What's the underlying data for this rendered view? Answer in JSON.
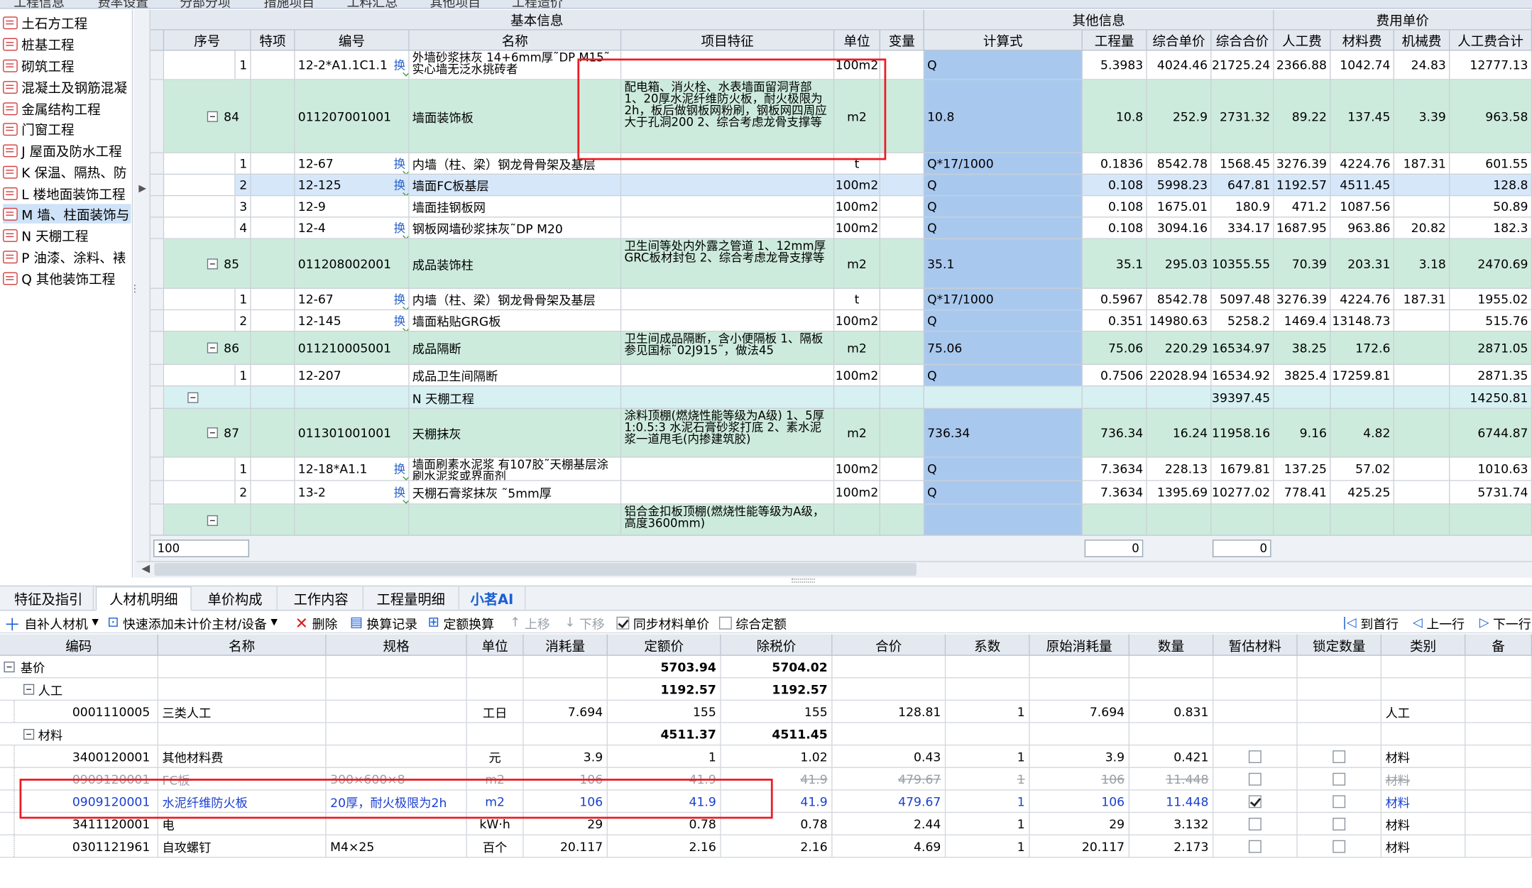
{
  "top_tabs": [
    "工程信息",
    "费率设置",
    "分部分项",
    "措施项目",
    "工料汇总",
    "其他项目",
    "工程造价"
  ],
  "left_tree": {
    "items": [
      "土石方工程",
      "桩基工程",
      "砌筑工程",
      "混凝土及钢筋混凝",
      "金属结构工程",
      "门窗工程",
      "J 屋面及防水工程",
      "K 保温、隔热、防",
      "L 楼地面装饰工程",
      "M 墙、柱面装饰与",
      "N 天棚工程",
      "P 油漆、涂料、裱",
      "Q 其他装饰工程"
    ],
    "selected_index": 9
  },
  "grid": {
    "group_headers": {
      "basic": "基本信息",
      "other": "其他信息",
      "fee": "费用单价"
    },
    "columns": [
      "序号",
      "特项",
      "编号",
      "名称",
      "项目特征",
      "单位",
      "变量",
      "计算式",
      "工程量",
      "综合单价",
      "综合合价",
      "人工费",
      "材料费",
      "机械费",
      "人工费合计"
    ],
    "rows": [
      {
        "seq": "1",
        "code": "12-2*A1.1C1.1",
        "huan": "换",
        "name": "外墙砂浆抹灰 14+6mm厚˜DP M15˜实心墙无泛水挑砖者",
        "feature": "",
        "unit": "100m2",
        "expr": "Q",
        "qty": "5.3983",
        "uprice": "4024.46",
        "total": "21725.24",
        "labor": "2366.88",
        "material": "1042.74",
        "machine": "24.83",
        "labor_total": "12777.13"
      },
      {
        "seq": "84",
        "code": "011207001001",
        "huan": "",
        "name": "墙面装饰板",
        "feature": "配电箱、消火栓、水表墙面留洞背部 1、20厚水泥纤维防火板，耐火极限为2h，板后做钢板网粉刷，钢板网四周应大于孔洞200 2、综合考虑龙骨支撑等",
        "unit": "m2",
        "expr": "10.8",
        "qty": "10.8",
        "uprice": "252.9",
        "total": "2731.32",
        "labor": "89.22",
        "material": "137.45",
        "machine": "3.39",
        "labor_total": "963.58"
      },
      {
        "seq": "1",
        "code": "12-67",
        "huan": "换",
        "name": "内墙（柱、梁）钢龙骨骨架及基层",
        "feature": "",
        "unit": "t",
        "expr": "Q*17/1000",
        "qty": "0.1836",
        "uprice": "8542.78",
        "total": "1568.45",
        "labor": "3276.39",
        "material": "4224.76",
        "machine": "187.31",
        "labor_total": "601.55"
      },
      {
        "seq": "2",
        "code": "12-125",
        "huan": "换",
        "name": "墙面FC板基层",
        "feature": "",
        "unit": "100m2",
        "expr": "Q",
        "qty": "0.108",
        "uprice": "5998.23",
        "total": "647.81",
        "labor": "1192.57",
        "material": "4511.45",
        "machine": "",
        "labor_total": "128.8"
      },
      {
        "seq": "3",
        "code": "12-9",
        "huan": "",
        "name": "墙面挂钢板网",
        "feature": "",
        "unit": "100m2",
        "expr": "Q",
        "qty": "0.108",
        "uprice": "1675.01",
        "total": "180.9",
        "labor": "471.2",
        "material": "1087.56",
        "machine": "",
        "labor_total": "50.89"
      },
      {
        "seq": "4",
        "code": "12-4",
        "huan": "换",
        "name": "钢板网墙砂浆抹灰˜DP M20",
        "feature": "",
        "unit": "100m2",
        "expr": "Q",
        "qty": "0.108",
        "uprice": "3094.16",
        "total": "334.17",
        "labor": "1687.95",
        "material": "963.86",
        "machine": "20.82",
        "labor_total": "182.3"
      },
      {
        "seq": "85",
        "code": "011208002001",
        "huan": "",
        "name": "成品装饰柱",
        "feature": "卫生间等处内外露之管道 1、12mm厚GRC板材封包 2、综合考虑龙骨支撑等",
        "unit": "m2",
        "expr": "35.1",
        "qty": "35.1",
        "uprice": "295.03",
        "total": "10355.55",
        "labor": "70.39",
        "material": "203.31",
        "machine": "3.18",
        "labor_total": "2470.69"
      },
      {
        "seq": "1",
        "code": "12-67",
        "huan": "换",
        "name": "内墙（柱、梁）钢龙骨骨架及基层",
        "feature": "",
        "unit": "t",
        "expr": "Q*17/1000",
        "qty": "0.5967",
        "uprice": "8542.78",
        "total": "5097.48",
        "labor": "3276.39",
        "material": "4224.76",
        "machine": "187.31",
        "labor_total": "1955.02"
      },
      {
        "seq": "2",
        "code": "12-145",
        "huan": "换",
        "name": "墙面粘贴GRG板",
        "feature": "",
        "unit": "100m2",
        "expr": "Q",
        "qty": "0.351",
        "uprice": "14980.63",
        "total": "5258.2",
        "labor": "1469.4",
        "material": "13148.73",
        "machine": "",
        "labor_total": "515.76"
      },
      {
        "seq": "86",
        "code": "011210005001",
        "huan": "",
        "name": "成品隔断",
        "feature": "卫生间成品隔断，含小便隔板 1、隔板参见国标˜02J915˜，做法45",
        "unit": "m2",
        "expr": "75.06",
        "qty": "75.06",
        "uprice": "220.29",
        "total": "16534.97",
        "labor": "38.25",
        "material": "172.6",
        "machine": "",
        "labor_total": "2871.05"
      },
      {
        "seq": "1",
        "code": "12-207",
        "huan": "",
        "name": "成品卫生间隔断",
        "feature": "",
        "unit": "100m2",
        "expr": "Q",
        "qty": "0.7506",
        "uprice": "22028.94",
        "total": "16534.92",
        "labor": "3825.4",
        "material": "17259.81",
        "machine": "",
        "labor_total": "2871.35"
      },
      {
        "seq": "",
        "code": "",
        "huan": "",
        "name": "N 天棚工程",
        "feature": "",
        "unit": "",
        "expr": "",
        "qty": "",
        "uprice": "",
        "total": "39397.45",
        "labor": "",
        "material": "",
        "machine": "",
        "labor_total": "14250.81"
      },
      {
        "seq": "87",
        "code": "011301001001",
        "huan": "",
        "name": "天棚抹灰",
        "feature": "涂料顶棚(燃烧性能等级为A级) 1、5厚1:0.5:3 水泥石膏砂浆打底 2、素水泥浆一道甩毛(内掺建筑胶)",
        "unit": "m2",
        "expr": "736.34",
        "qty": "736.34",
        "uprice": "16.24",
        "total": "11958.16",
        "labor": "9.16",
        "material": "4.82",
        "machine": "",
        "labor_total": "6744.87"
      },
      {
        "seq": "1",
        "code": "12-18*A1.1",
        "huan": "换",
        "name": "墙面刷素水泥浆 有107胶˜天棚基层涂刷水泥浆或界面剂",
        "feature": "",
        "unit": "100m2",
        "expr": "Q",
        "qty": "7.3634",
        "uprice": "228.13",
        "total": "1679.81",
        "labor": "137.25",
        "material": "57.02",
        "machine": "",
        "labor_total": "1010.63"
      },
      {
        "seq": "2",
        "code": "13-2",
        "huan": "换",
        "name": "天棚石膏浆抹灰 ˜5mm厚",
        "feature": "",
        "unit": "100m2",
        "expr": "Q",
        "qty": "7.3634",
        "uprice": "1395.69",
        "total": "10277.02",
        "labor": "778.41",
        "material": "425.25",
        "machine": "",
        "labor_total": "5731.74"
      },
      {
        "seq": "",
        "code": "",
        "huan": "",
        "name": "",
        "feature": "铝合金扣板顶棚(燃烧性能等级为A级，高度3600mm)",
        "unit": "",
        "expr": "",
        "qty": "",
        "uprice": "",
        "total": "",
        "labor": "",
        "material": "",
        "machine": "",
        "labor_total": ""
      }
    ],
    "summary": {
      "input_left": "100",
      "input_qty": "0",
      "input_total": "0"
    }
  },
  "bottom_tabs": [
    "特征及指引",
    "人材机明细",
    "单价构成",
    "工作内容",
    "工程量明细",
    "小茗AI"
  ],
  "bottom_active": 1,
  "toolbar": {
    "add": "自补人材机",
    "quick_add": "快速添加未计价主材/设备",
    "delete": "删除",
    "history": "换算记录",
    "quota": "定额换算",
    "up": "上移",
    "down": "下移",
    "sync": "同步材料单价",
    "combined": "综合定额",
    "first": "到首行",
    "prev": "上一行",
    "next": "下一行"
  },
  "detail": {
    "columns": [
      "编码",
      "名称",
      "规格",
      "单位",
      "消耗量",
      "定额价",
      "除税价",
      "合价",
      "系数",
      "原始消耗量",
      "数量",
      "暂估材料",
      "锁定数量",
      "类别",
      "备"
    ],
    "rows": [
      {
        "code": "基价",
        "name": "",
        "spec": "",
        "unit": "",
        "consume": "",
        "quota": "5703.94",
        "notax": "5704.02",
        "total": "",
        "coef": "",
        "orig": "",
        "qty": "",
        "est": null,
        "lock": null,
        "cat": ""
      },
      {
        "code": "人工",
        "name": "",
        "spec": "",
        "unit": "",
        "consume": "",
        "quota": "1192.57",
        "notax": "1192.57",
        "total": "",
        "coef": "",
        "orig": "",
        "qty": "",
        "est": null,
        "lock": null,
        "cat": ""
      },
      {
        "code": "0001110005",
        "name": "三类人工",
        "spec": "",
        "unit": "工日",
        "consume": "7.694",
        "quota": "155",
        "notax": "155",
        "total": "128.81",
        "coef": "1",
        "orig": "7.694",
        "qty": "0.831",
        "est": null,
        "lock": null,
        "cat": "人工"
      },
      {
        "code": "材料",
        "name": "",
        "spec": "",
        "unit": "",
        "consume": "",
        "quota": "4511.37",
        "notax": "4511.45",
        "total": "",
        "coef": "",
        "orig": "",
        "qty": "",
        "est": null,
        "lock": null,
        "cat": ""
      },
      {
        "code": "3400120001",
        "name": "其他材料费",
        "spec": "",
        "unit": "元",
        "consume": "3.9",
        "quota": "1",
        "notax": "1.02",
        "total": "0.43",
        "coef": "1",
        "orig": "3.9",
        "qty": "0.421",
        "est": false,
        "lock": false,
        "cat": "材料"
      },
      {
        "code": "0909120001",
        "name": "FC板",
        "spec": "300×600×8",
        "unit": "m2",
        "consume": "106",
        "quota": "41.9",
        "notax": "41.9",
        "total": "479.67",
        "coef": "1",
        "orig": "106",
        "qty": "11.448",
        "est": false,
        "lock": false,
        "cat": "材料"
      },
      {
        "code": "0909120001",
        "name": "水泥纤维防火板",
        "spec": "20厚，耐火极限为2h",
        "unit": "m2",
        "consume": "106",
        "quota": "41.9",
        "notax": "41.9",
        "total": "479.67",
        "coef": "1",
        "orig": "106",
        "qty": "11.448",
        "est": true,
        "lock": false,
        "cat": "材料"
      },
      {
        "code": "3411120001",
        "name": "电",
        "spec": "",
        "unit": "kW·h",
        "consume": "29",
        "quota": "0.78",
        "notax": "0.78",
        "total": "2.44",
        "coef": "1",
        "orig": "29",
        "qty": "3.132",
        "est": false,
        "lock": false,
        "cat": "材料"
      },
      {
        "code": "0301121961",
        "name": "自攻螺钉",
        "spec": "M4×25",
        "unit": "百个",
        "consume": "20.117",
        "quota": "2.16",
        "notax": "2.16",
        "total": "4.69",
        "coef": "1",
        "orig": "20.117",
        "qty": "2.173",
        "est": false,
        "lock": false,
        "cat": "材料"
      }
    ]
  },
  "colors": {
    "green_row": "#cdebdc",
    "selected_row": "#d6e7fa",
    "expr_col": "#a9c8ee",
    "header": "#e4e9f0",
    "highlight": "#ec1c24",
    "blue_text": "#1a3fd1"
  }
}
